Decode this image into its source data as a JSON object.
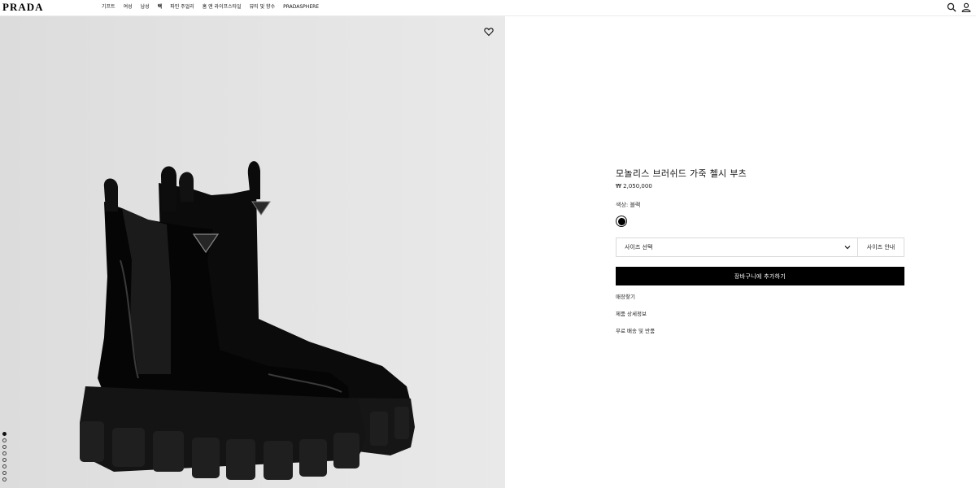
{
  "brand": {
    "logo": "PRADA"
  },
  "nav": {
    "items": [
      {
        "label": "기프트",
        "bold": false
      },
      {
        "label": "여성",
        "bold": false
      },
      {
        "label": "남성",
        "bold": false
      },
      {
        "label": "백",
        "bold": true
      },
      {
        "label": "파인 주얼리",
        "bold": false
      },
      {
        "label": "홈 앤 라이프스타일",
        "bold": false
      },
      {
        "label": "뷰티 및 향수",
        "bold": false
      },
      {
        "label": "PRADASPHERE",
        "bold": false
      }
    ]
  },
  "header_icons": [
    "search-icon",
    "account-icon"
  ],
  "gallery": {
    "wishlist_icon": "heart-icon",
    "slide_count": 8,
    "active_slide": 1
  },
  "product": {
    "title": "모놀리스 브러쉬드 가죽 첼시 부츠",
    "price": "₩ 2,050,000",
    "color_label": "색상: 블랙",
    "swatch_color": "#000000",
    "size_placeholder": "사이즈 선택",
    "size_guide": "사이즈 안내",
    "add_to_cart": "장바구니에 추가하기",
    "links": [
      "매장찾기",
      "제품 상세정보",
      "무료 배송 및 반품"
    ]
  }
}
